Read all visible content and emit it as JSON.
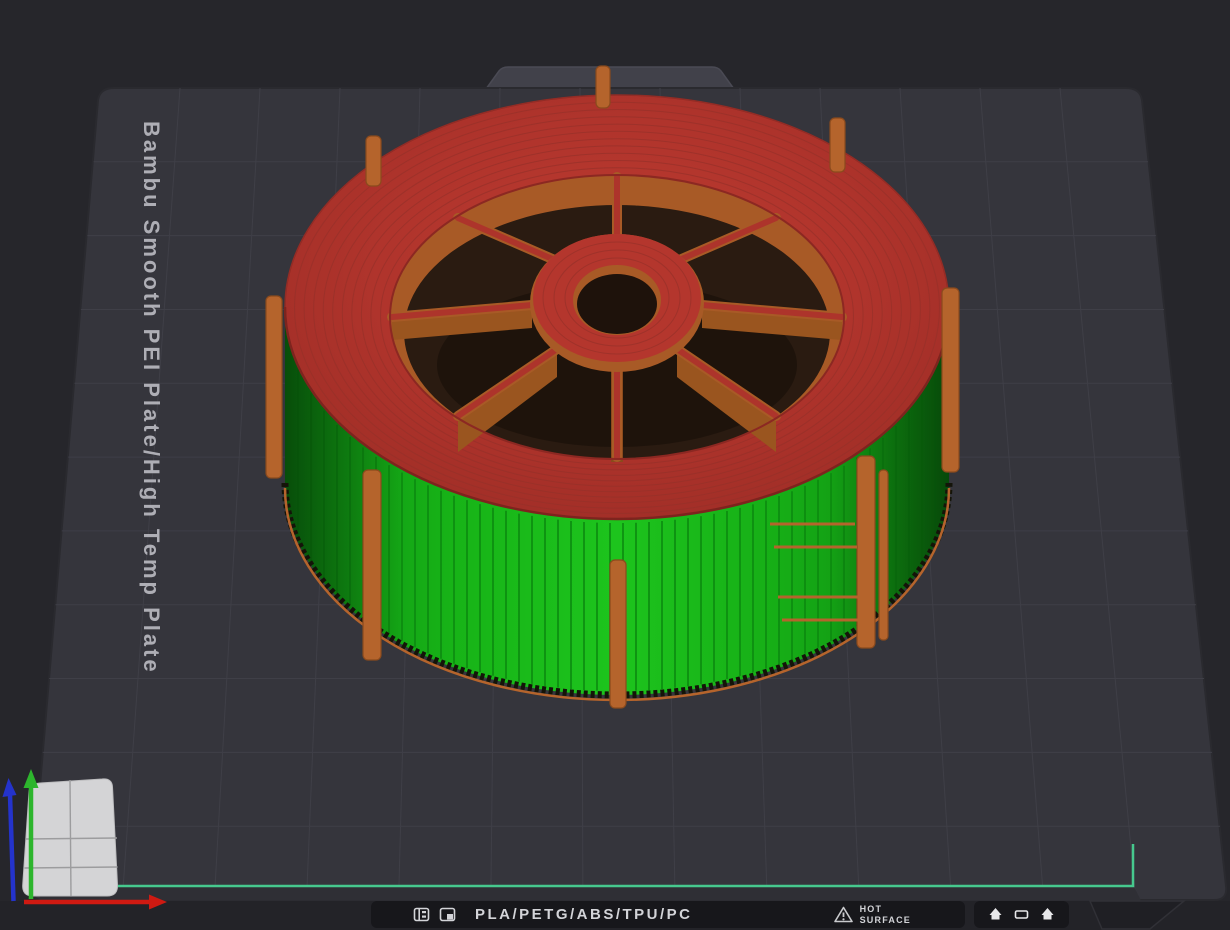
{
  "viewport": {
    "plate_label": "Bambu Smooth PEI Plate/High Temp Plate"
  },
  "plate_bar": {
    "materials": "PLA/PETG/ABS/TPU/PC",
    "warning": {
      "line1": "HOT",
      "line2": "SURFACE"
    },
    "icons": {
      "left": [
        "plate-type-icon",
        "plate-texture-icon"
      ],
      "warning": "hot-surface-warning-icon",
      "right": [
        "clip-up-icon",
        "plate-outline-icon",
        "clip-up-icon"
      ]
    }
  },
  "colors": {
    "background": "#26262b",
    "plate": "#35353c",
    "grid_line": "#3f3f47",
    "model_top": "#b0342c",
    "model_interior": "#a85a26",
    "model_side": "#17b317",
    "model_ribs": "#b5642c",
    "first_layer_outline": "#46c98e",
    "axis_x": "#cf1a12",
    "axis_y": "#2db52d",
    "axis_z": "#2433cc"
  }
}
